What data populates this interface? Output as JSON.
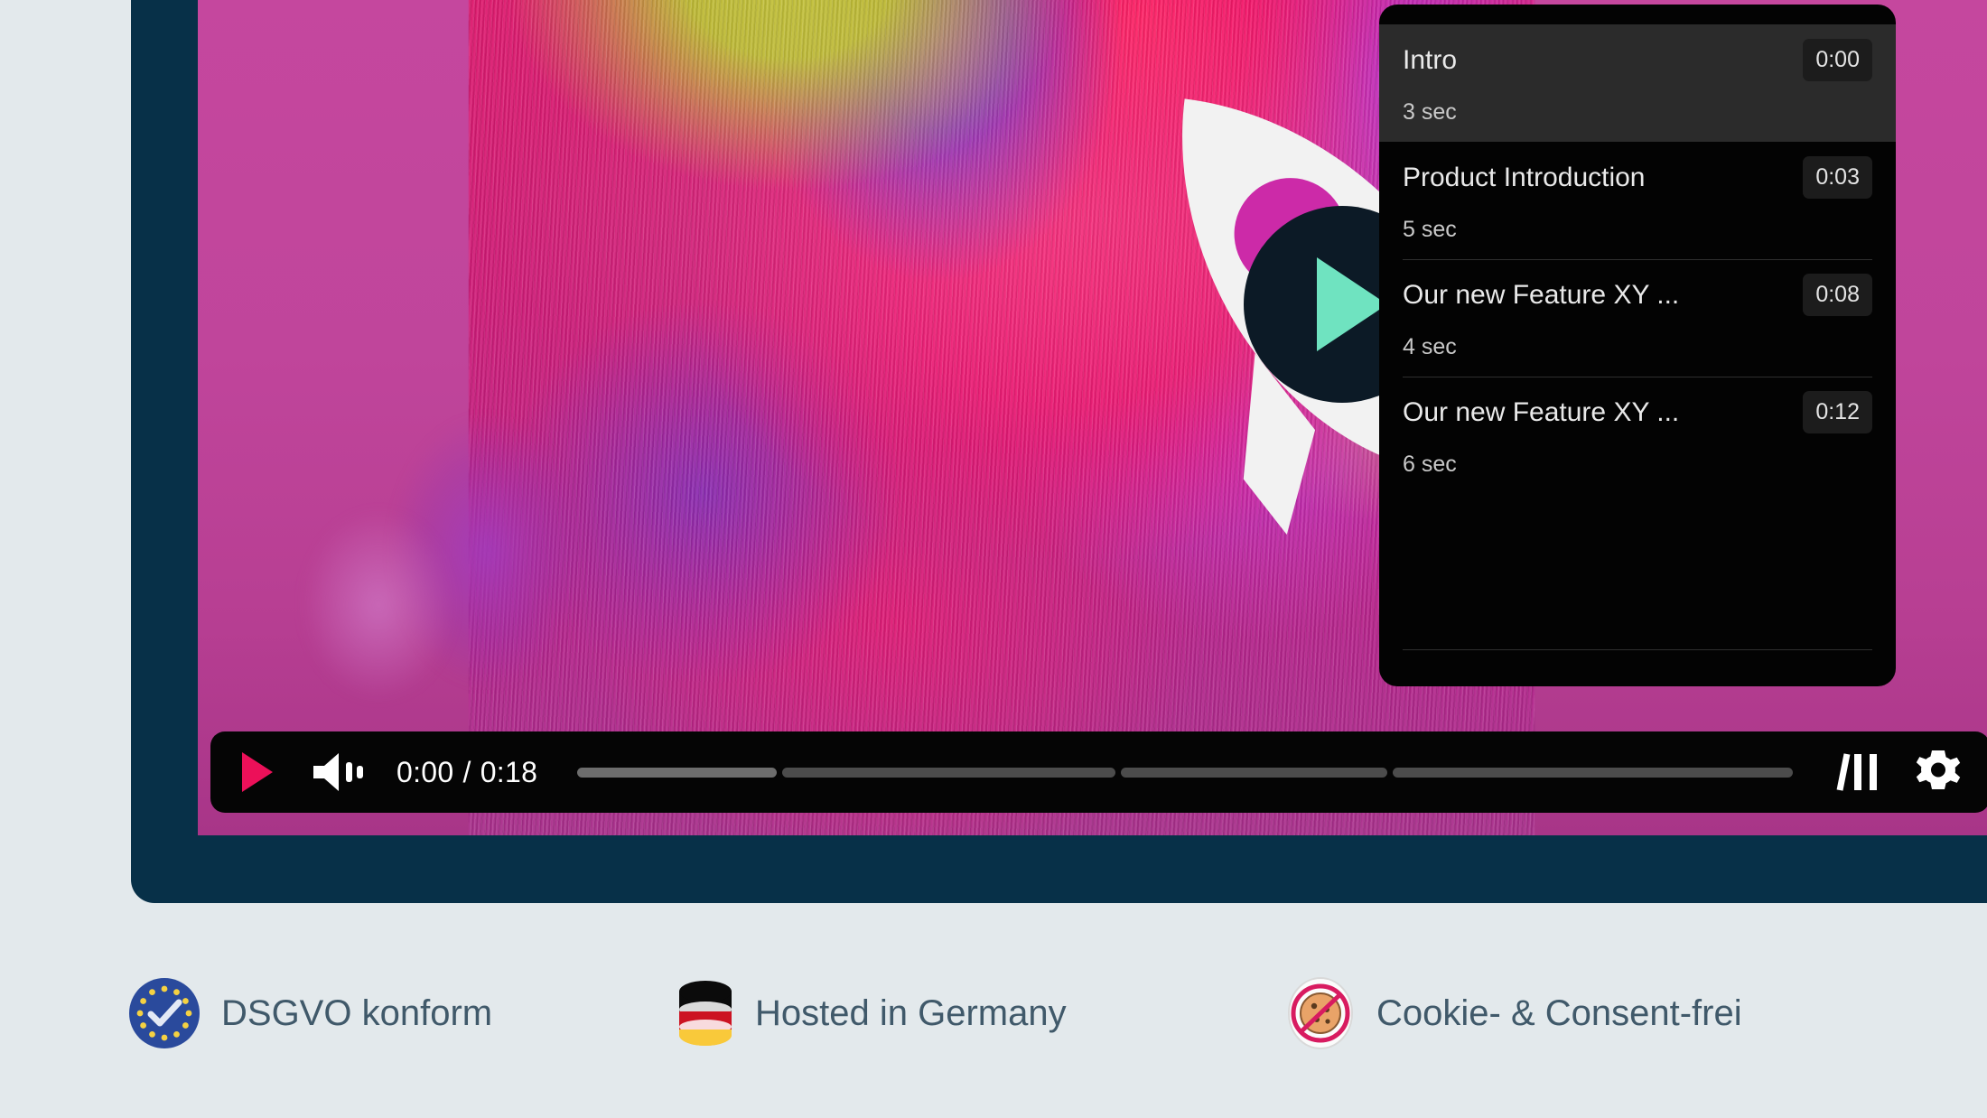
{
  "player": {
    "frame_color": "#073048",
    "page_background": "#e3e9ec",
    "center_play": {
      "icon": "play-triangle-icon",
      "fill": "#6fe3c0",
      "disc": "#0c1a26"
    },
    "logo": {
      "icon": "rocket-logo",
      "fill": "#f2f2f2"
    }
  },
  "controls": {
    "play_icon": "play-triangle-icon",
    "play_color": "#ec1059",
    "volume_icon": "speaker-wave-icon",
    "current_time": "0:00",
    "separator": "/",
    "duration": "0:18",
    "chapters_icon": "chapters-bars-icon",
    "settings_icon": "gear-icon",
    "progress": {
      "segments": [
        {
          "label": "Intro",
          "weight": 3,
          "state": "hot"
        },
        {
          "label": "Product Introduction",
          "weight": 5,
          "state": "idle"
        },
        {
          "label": "Our new Feature XY ...",
          "weight": 4,
          "state": "idle"
        },
        {
          "label": "Our new Feature XY ...",
          "weight": 6,
          "state": "idle"
        }
      ]
    }
  },
  "chapters": {
    "items": [
      {
        "title": "Intro",
        "start": "0:00",
        "duration": "3 sec",
        "active": true
      },
      {
        "title": "Product Introduction",
        "start": "0:03",
        "duration": "5 sec",
        "active": false
      },
      {
        "title": "Our new Feature XY ...",
        "start": "0:08",
        "duration": "4 sec",
        "active": false
      },
      {
        "title": "Our new Feature XY ...",
        "start": "0:12",
        "duration": "6 sec",
        "active": false
      }
    ]
  },
  "trust_badges": [
    {
      "id": "dsgvo",
      "label": "DSGVO konform",
      "icon": "eu-flag-check-icon"
    },
    {
      "id": "hosting",
      "label": "Hosted in Germany",
      "icon": "german-flag-database-icon"
    },
    {
      "id": "cookie",
      "label": "Cookie- & Consent-frei",
      "icon": "no-cookie-icon"
    }
  ],
  "colors": {
    "text_slate": "#40596a",
    "accent_pink": "#ec1059",
    "accent_mint": "#6fe3c0",
    "panel_bg": "#030303",
    "panel_active": "#2b2b2b"
  }
}
